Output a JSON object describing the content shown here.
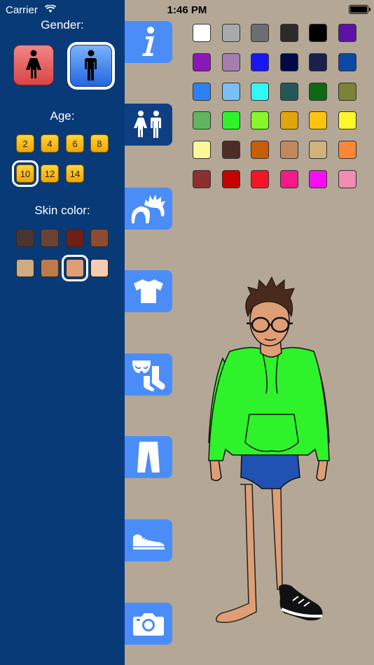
{
  "status": {
    "carrier": "Carrier",
    "time": "1:46 PM"
  },
  "sidebar": {
    "gender_label": "Gender:",
    "age_label": "Age:",
    "skin_label": "Skin color:",
    "genders": [
      {
        "name": "female",
        "icon": "female-figure-icon",
        "selected": false
      },
      {
        "name": "male",
        "icon": "male-figure-icon",
        "selected": true
      }
    ],
    "ages": [
      "2",
      "4",
      "6",
      "8",
      "10",
      "12",
      "14"
    ],
    "selected_age": "10",
    "skin_colors": [
      "#4b3530",
      "#6b4332",
      "#6c2016",
      "#8f4b30",
      "#cfab82",
      "#c07a4a",
      "#de9e76",
      "#f8ccb2"
    ],
    "selected_skin_index": 6
  },
  "tabs": [
    {
      "name": "info",
      "icon": "info-icon",
      "active": false
    },
    {
      "name": "body",
      "icon": "gender-icon",
      "active": true
    },
    {
      "name": "hair",
      "icon": "hair-icon",
      "active": false
    },
    {
      "name": "shirt",
      "icon": "tshirt-icon",
      "active": false
    },
    {
      "name": "underwear",
      "icon": "underwear-socks-icon",
      "active": false
    },
    {
      "name": "pants",
      "icon": "pants-icon",
      "active": false
    },
    {
      "name": "shoes",
      "icon": "shoe-icon",
      "active": false
    },
    {
      "name": "camera",
      "icon": "camera-icon",
      "active": false
    }
  ],
  "palette": [
    "#ffffff",
    "#a7a9ab",
    "#6d6e70",
    "#2b2b2b",
    "#000000",
    "#5d12a5",
    "#8a18b8",
    "#a47fae",
    "#1816f2",
    "#000a48",
    "#1a1f4c",
    "#0d48a5",
    "#2c82f4",
    "#77bff4",
    "#30f8f8",
    "#245858",
    "#0e6814",
    "#7b8334",
    "#5fb65f",
    "#2ef22a",
    "#85f72a",
    "#e2a40c",
    "#fcc313",
    "#fdf62f",
    "#fbf898",
    "#4e2d28",
    "#c85d08",
    "#c1895b",
    "#d0b27c",
    "#fd8538",
    "#8e2f2d",
    "#c10303",
    "#f21626",
    "#f41a88",
    "#f80ef4",
    "#f08db1"
  ],
  "character": {
    "hoodie_color": "#2ef22a",
    "briefs_color": "#2052b3",
    "skin_color": "#de9e76"
  }
}
